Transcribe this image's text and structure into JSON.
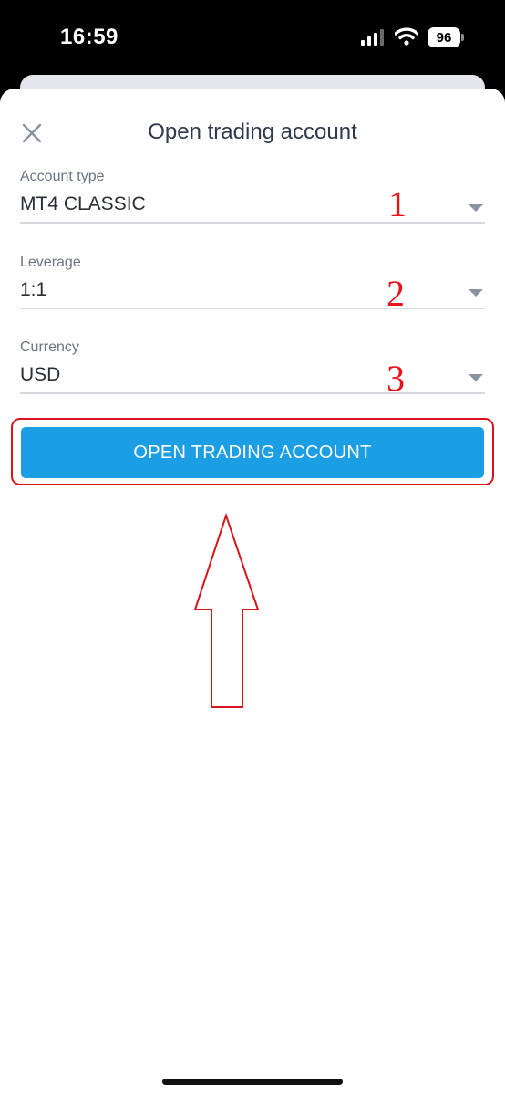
{
  "status_bar": {
    "time": "16:59",
    "battery": "96"
  },
  "header": {
    "title": "Open trading account"
  },
  "form": {
    "fields": [
      {
        "label": "Account type",
        "value": "MT4 CLASSIC"
      },
      {
        "label": "Leverage",
        "value": "1:1"
      },
      {
        "label": "Currency",
        "value": "USD"
      }
    ],
    "submit_label": "OPEN TRADING ACCOUNT"
  },
  "annotations": {
    "steps": [
      "1",
      "2",
      "3"
    ],
    "color": "#e8141b"
  },
  "colors": {
    "accent": "#1c9ee4",
    "title": "#2f3b4d"
  }
}
